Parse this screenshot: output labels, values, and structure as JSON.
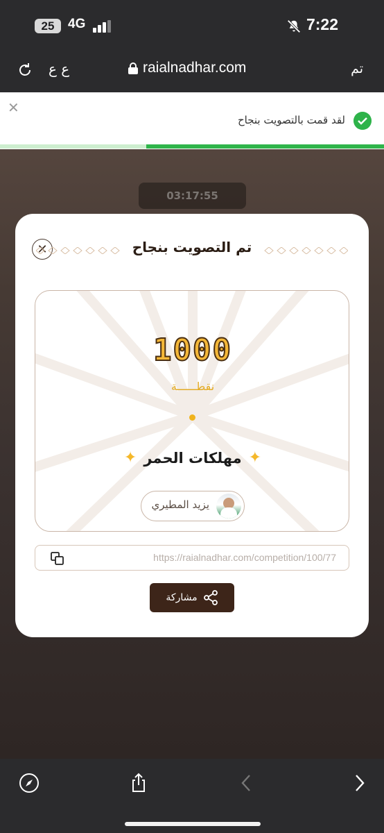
{
  "status_bar": {
    "battery": "25",
    "network": "4G",
    "time": "7:22"
  },
  "browser": {
    "text_size": "ع ع",
    "url": "raialnadhar.com",
    "done": "تم"
  },
  "toast": {
    "message": "لقد قمت بالتصويت بنجاح",
    "progress": 0.62
  },
  "background": {
    "timer": "03:17:55"
  },
  "modal": {
    "title": "تم التصويت بنجاح",
    "points": "1000",
    "points_label": "نقطــــــة",
    "team_name": "مهلكات الحمر",
    "person_name": "يزيد المطيري",
    "share_link": "https://raialnadhar.com/competition/100/77",
    "share_label": "مشاركة"
  },
  "colors": {
    "accent_gold": "#f4b738",
    "share_button": "#3d2519",
    "success_green": "#2fb44a"
  },
  "icons": [
    "reload-icon",
    "lock-icon",
    "close-icon",
    "check-icon",
    "copy-icon",
    "share-icon",
    "compass-icon",
    "share-sheet-icon",
    "back-icon",
    "forward-icon"
  ]
}
